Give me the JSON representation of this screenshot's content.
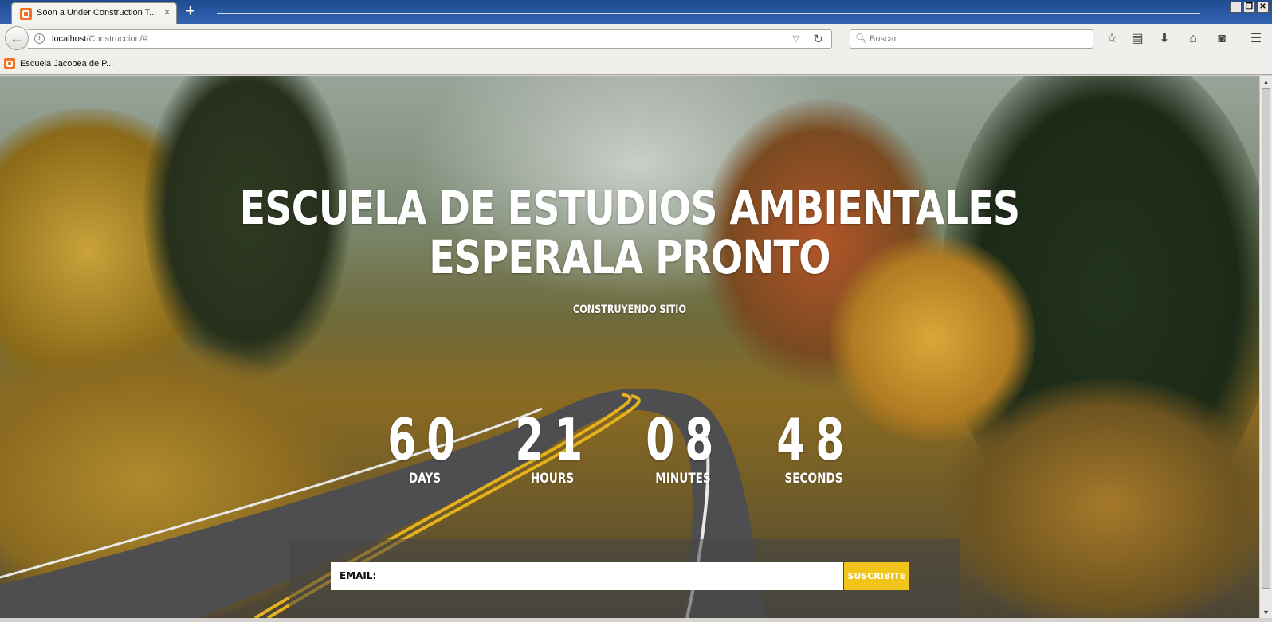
{
  "browser": {
    "tab_title": "Soon a Under Construction T...",
    "tab_close": "×",
    "new_tab": "+",
    "url_host": "localhost",
    "url_path": "/Construccion/#",
    "search_placeholder": "Buscar",
    "bookmark_label": "Escuela Jacobea de P...",
    "window_buttons": [
      "_",
      "❐",
      "✕"
    ],
    "toolbar_icons": [
      "star-icon",
      "reading-list-icon",
      "download-icon",
      "home-icon",
      "pocket-icon",
      "menu-icon"
    ]
  },
  "page": {
    "headline_line1": "ESCUELA DE ESTUDIOS AMBIENTALES",
    "headline_line2": "ESPERALA PRONTO",
    "tagline": "CONSTRUYENDO SITIO",
    "countdown": [
      {
        "value": "60",
        "label": "DAYS"
      },
      {
        "value": "21",
        "label": "HOURS"
      },
      {
        "value": "08",
        "label": "MINUTES"
      },
      {
        "value": "48",
        "label": "SECONDS"
      }
    ],
    "email_label": "EMAIL:",
    "subscribe_button": "SUSCRIBITE"
  },
  "colors": {
    "accent": "#f0c419",
    "tab_bar": "#2b5aa6",
    "favicon": "#f37021"
  }
}
